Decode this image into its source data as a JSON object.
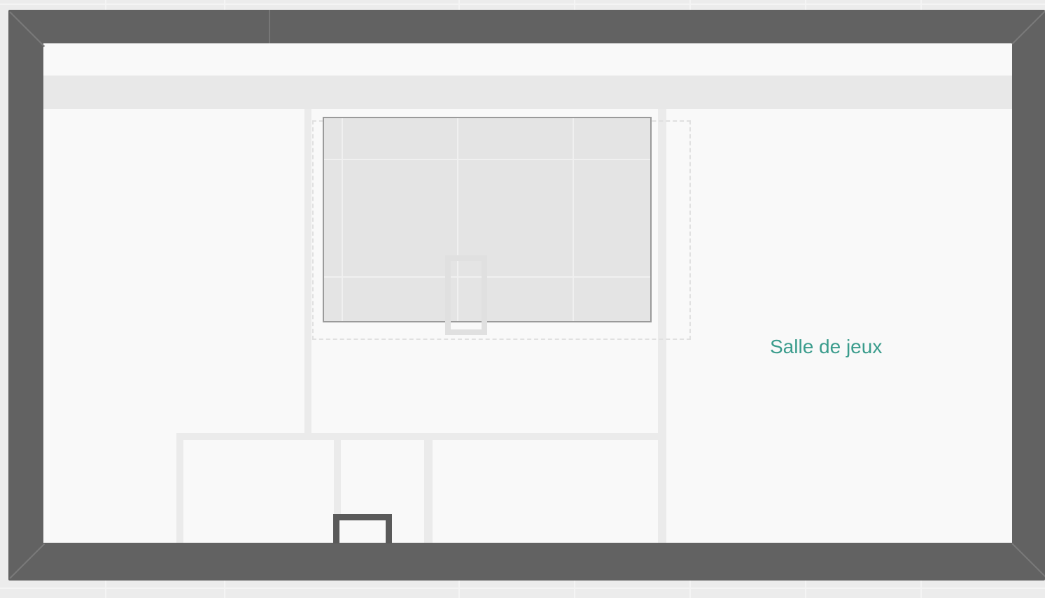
{
  "floorplan": {
    "room_label": "Salle de jeux"
  },
  "colors": {
    "wall": "#626262",
    "floor": "#f9f9f9",
    "label": "#3a9c8c",
    "furniture": "#e4e4e4"
  }
}
